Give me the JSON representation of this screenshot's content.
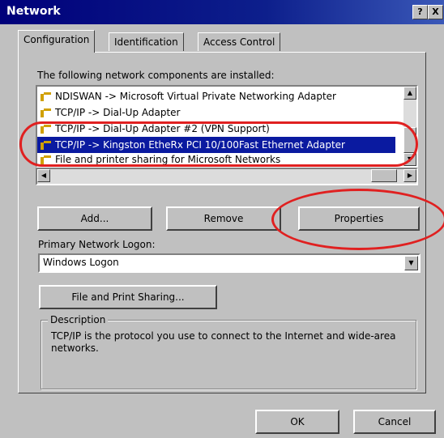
{
  "window": {
    "title": "Network",
    "help_button": "?",
    "close_button": "X"
  },
  "tabs": [
    "Configuration",
    "Identification",
    "Access Control"
  ],
  "components": {
    "label": "The following network components are installed:",
    "items": [
      "NDISWAN -> Microsoft Virtual Private Networking Adapter",
      "TCP/IP -> Dial-Up Adapter",
      "TCP/IP -> Dial-Up Adapter #2 (VPN Support)",
      "TCP/IP -> Kingston EtheRx PCI 10/100Fast Ethernet Adapter",
      "File and printer sharing for Microsoft Networks"
    ],
    "selected_index": 3
  },
  "buttons": {
    "add": "Add...",
    "remove": "Remove",
    "properties": "Properties",
    "file_print_sharing": "File and Print Sharing...",
    "ok": "OK",
    "cancel": "Cancel"
  },
  "logon": {
    "label": "Primary Network Logon:",
    "value": "Windows Logon"
  },
  "description": {
    "title": "Description",
    "text": "TCP/IP is the protocol you use to connect to the Internet and wide-area networks."
  },
  "colors": {
    "selection": "#0a1aa0",
    "annotation": "#e02020"
  }
}
